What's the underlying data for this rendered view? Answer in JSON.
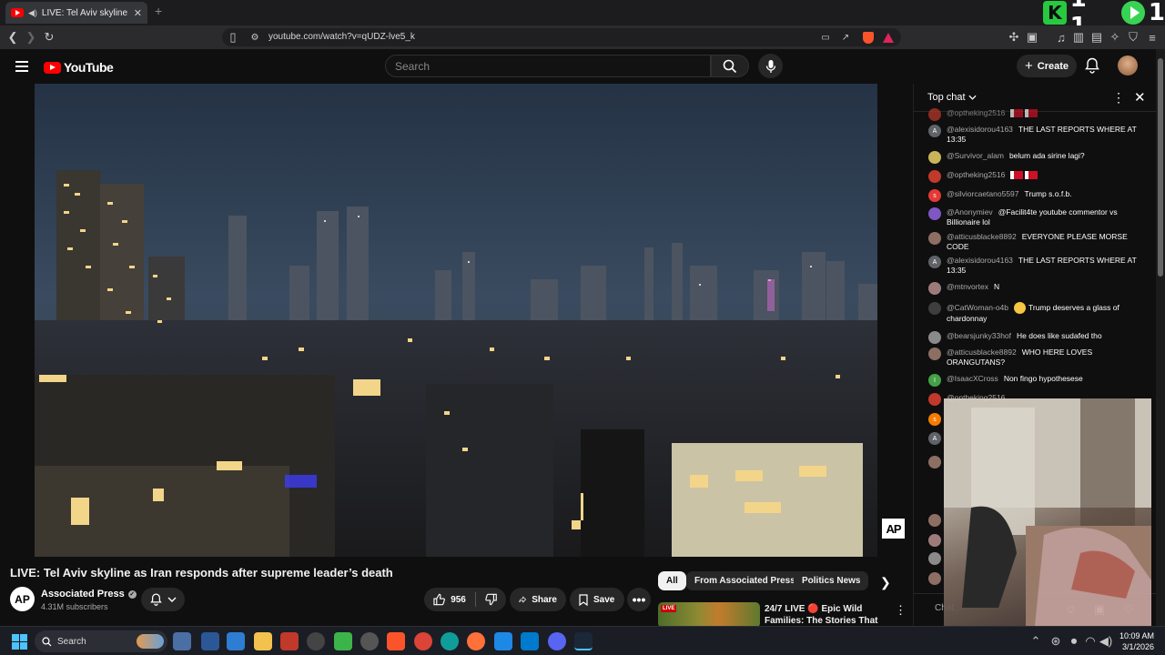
{
  "browser": {
    "tab_title": "LIVE: Tel Aviv skyline view as I",
    "url": "youtube.com/watch?v=qUDZ-lve5_k",
    "overlay_counter_a": "1 1",
    "overlay_counter_b": "1"
  },
  "youtube": {
    "logo_text": "YouTube",
    "search_placeholder": "Search",
    "create_label": "Create"
  },
  "video": {
    "title": "LIVE: Tel Aviv skyline as Iran responds after supreme leader’s death",
    "channel_initials": "AP",
    "channel_name": "Associated Press",
    "subscribers": "4.31M subscribers",
    "likes": "956",
    "share_label": "Share",
    "save_label": "Save",
    "watermark": "AP"
  },
  "chips": [
    "All",
    "From Associated Press",
    "Politics News"
  ],
  "recommendation": {
    "title": "24/7 LIVE 🔴 Epic Wild Families: The Stories That …",
    "badge": "LIVE"
  },
  "chat": {
    "header": "Top chat",
    "input_placeholder": "Chat...",
    "messages": [
      {
        "author": "@alexisidorou4163",
        "text": "THE LAST REPORTS WHERE AT 13:35",
        "avatar": "A",
        "color": "#5f6368"
      },
      {
        "author": "@Survivor_alam",
        "text": "belum ada sirine lagi?",
        "avatar": "",
        "color": "#c9b458"
      },
      {
        "author": "@optheking2516",
        "text": "",
        "avatar": "",
        "color": "#c0392b"
      },
      {
        "author": "@silviorcaetano5597",
        "text": "Trump s.o.f.b.",
        "avatar": "s",
        "color": "#e53935"
      },
      {
        "author": "@Anonymiev",
        "text": "@Facilit4te youtube commentor vs Billionaire lol",
        "avatar": "",
        "color": "#7e57c2"
      },
      {
        "author": "@atticusblacke8892",
        "text": "EVERYONE PLEASE MORSE CODE",
        "avatar": "",
        "color": "#8d6e63"
      },
      {
        "author": "@alexisidorou4163",
        "text": "THE LAST REPORTS WHERE AT 13:35",
        "avatar": "A",
        "color": "#5f6368"
      },
      {
        "author": "@mtnvortex",
        "text": "N",
        "avatar": "",
        "color": "#9e7b7b"
      },
      {
        "author": "@CatWoman-o4b",
        "text": "Trump deserves a glass of chardonnay",
        "avatar": "",
        "color": "#3e3e3e"
      },
      {
        "author": "@bearsjunky33hof",
        "text": "He does like sudafed tho",
        "avatar": "",
        "color": "#8a8a8a"
      },
      {
        "author": "@atticusblacke8892",
        "text": "WHO HERE LOVES ORANGUTANS?",
        "avatar": "",
        "color": "#8d6e63"
      },
      {
        "author": "@IsaacXCross",
        "text": "Non fingo hypothesese",
        "avatar": "I",
        "color": "#43a047"
      },
      {
        "author": "@optheking2516",
        "text": "",
        "avatar": "",
        "color": "#c0392b"
      }
    ],
    "partial_top_author": "@optheking2516"
  },
  "taskbar": {
    "search_label": "Search",
    "time": "10:09 AM",
    "date": "3/1/2026"
  }
}
